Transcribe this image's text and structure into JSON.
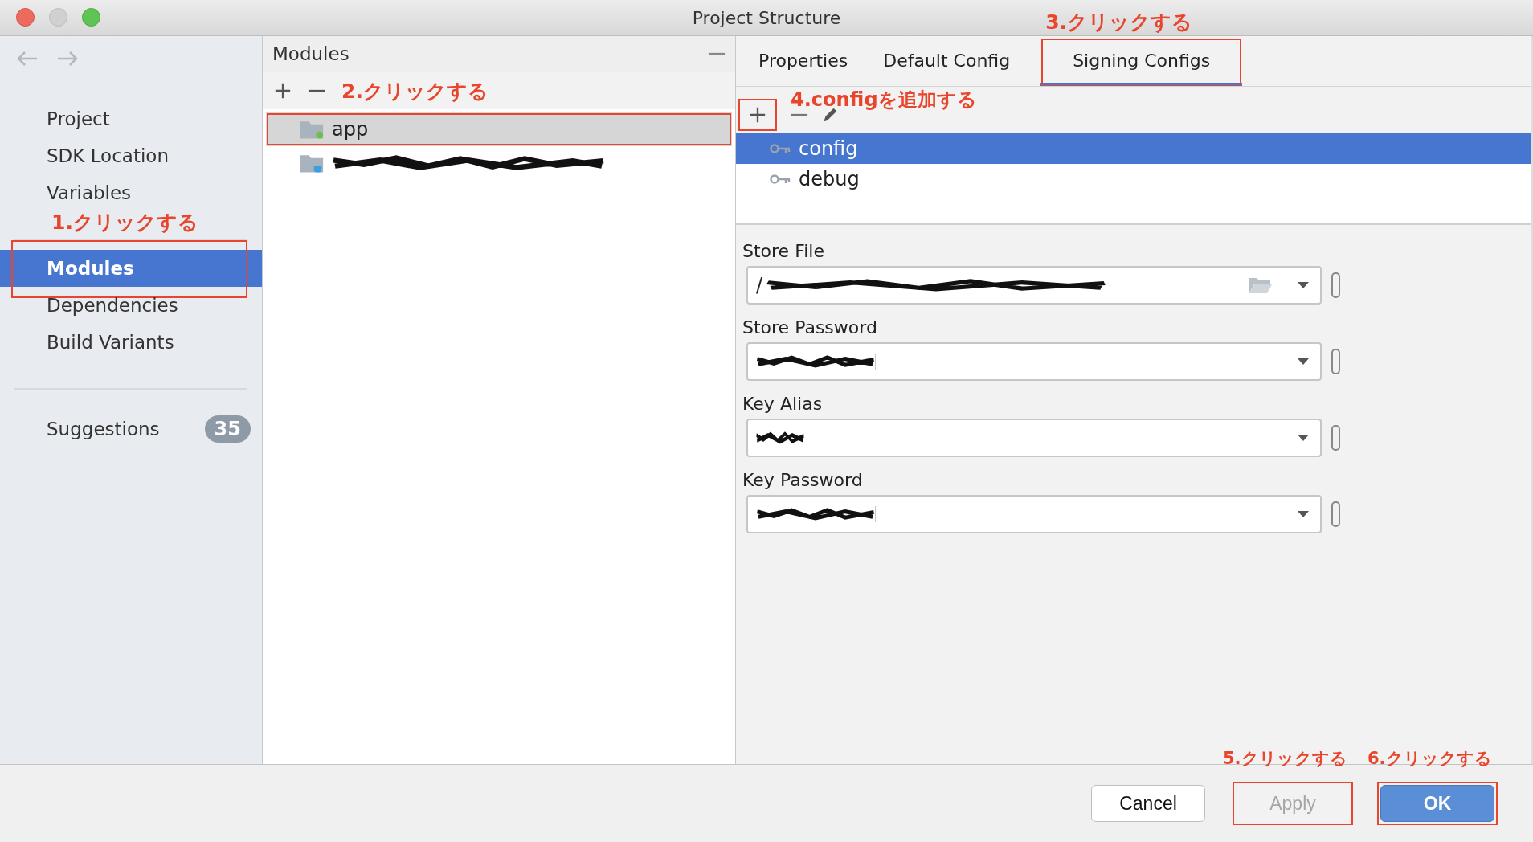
{
  "window": {
    "title": "Project Structure"
  },
  "sidebar": {
    "items": [
      {
        "label": "Project",
        "selected": false,
        "marked": false
      },
      {
        "label": "SDK Location",
        "selected": false,
        "marked": false
      },
      {
        "label": "Variables",
        "selected": false,
        "marked": false
      },
      {
        "label": "Modules",
        "selected": true,
        "marked": true,
        "note": "1.クリックする"
      },
      {
        "label": "Dependencies",
        "selected": false,
        "marked": false
      },
      {
        "label": "Build Variants",
        "selected": false,
        "marked": false
      }
    ],
    "suggestions": {
      "label": "Suggestions",
      "count": "35"
    }
  },
  "modules": {
    "title": "Modules",
    "toolbar_note": "2.クリックする",
    "rows": [
      {
        "kind": "named",
        "name": "app",
        "selected": true,
        "marked": true
      },
      {
        "kind": "redacted",
        "selected": false,
        "marked": false
      }
    ]
  },
  "tabs": [
    {
      "label": "Properties",
      "selected": false,
      "marked": false
    },
    {
      "label": "Default Config",
      "selected": false,
      "marked": false
    },
    {
      "label": "Signing Configs",
      "selected": true,
      "marked": true,
      "note": "3.クリックする"
    }
  ],
  "config_toolbar": {
    "add_marked": true,
    "add_note": "4.configを追加する"
  },
  "configs": [
    {
      "name": "config",
      "selected": true
    },
    {
      "name": "debug",
      "selected": false
    }
  ],
  "fields": [
    {
      "label": "Store File",
      "value": "/",
      "browse": true
    },
    {
      "label": "Store Password",
      "browse": false
    },
    {
      "label": "Key Alias",
      "browse": false
    },
    {
      "label": "Key Password",
      "browse": false
    }
  ],
  "buttons": [
    {
      "kind": "plain",
      "label": "Cancel",
      "disabled": false,
      "marked": false
    },
    {
      "kind": "plain",
      "label": "Apply",
      "disabled": true,
      "marked": true,
      "note": "5.クリックする"
    },
    {
      "kind": "default",
      "label": "OK",
      "disabled": false,
      "marked": true,
      "note": "6.クリックする"
    }
  ]
}
